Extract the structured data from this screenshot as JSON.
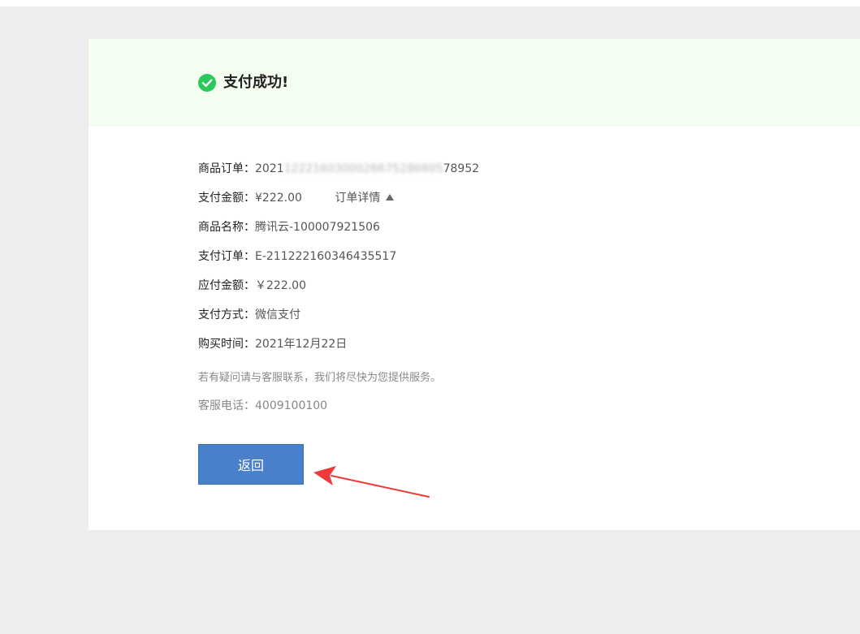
{
  "banner": {
    "title": "支付成功!",
    "icon": "check-circle-icon",
    "color": "#2bc85d",
    "background": "#f3fdf0"
  },
  "order": {
    "product_order": {
      "label": "商品订单：",
      "value_visible_start": "2021",
      "value_blurred": "1222160300026675286605",
      "value_visible_end": "78952"
    },
    "amount": {
      "label": "支付金额：",
      "value": "¥222.00"
    },
    "details_link": "订单详情",
    "product_name": {
      "label": "商品名称：",
      "value": "腾讯云-100007921506"
    },
    "payment_order": {
      "label": "支付订单：",
      "value": "E-211222160346435517"
    },
    "payable": {
      "label": "应付金额：",
      "value": "￥222.00"
    },
    "method": {
      "label": "支付方式：",
      "value": "微信支付"
    },
    "purchase_time": {
      "label": "购买时间：",
      "value": "2021年12月22日"
    }
  },
  "support": {
    "notice": "若有疑问请与客服联系，我们将尽快为您提供服务。",
    "hotline_label": "客服电话：",
    "hotline_value": "4009100100"
  },
  "actions": {
    "back_label": "返回",
    "back_color": "#4a7fc9"
  },
  "annotation": {
    "arrow_color": "#f03a3a"
  }
}
